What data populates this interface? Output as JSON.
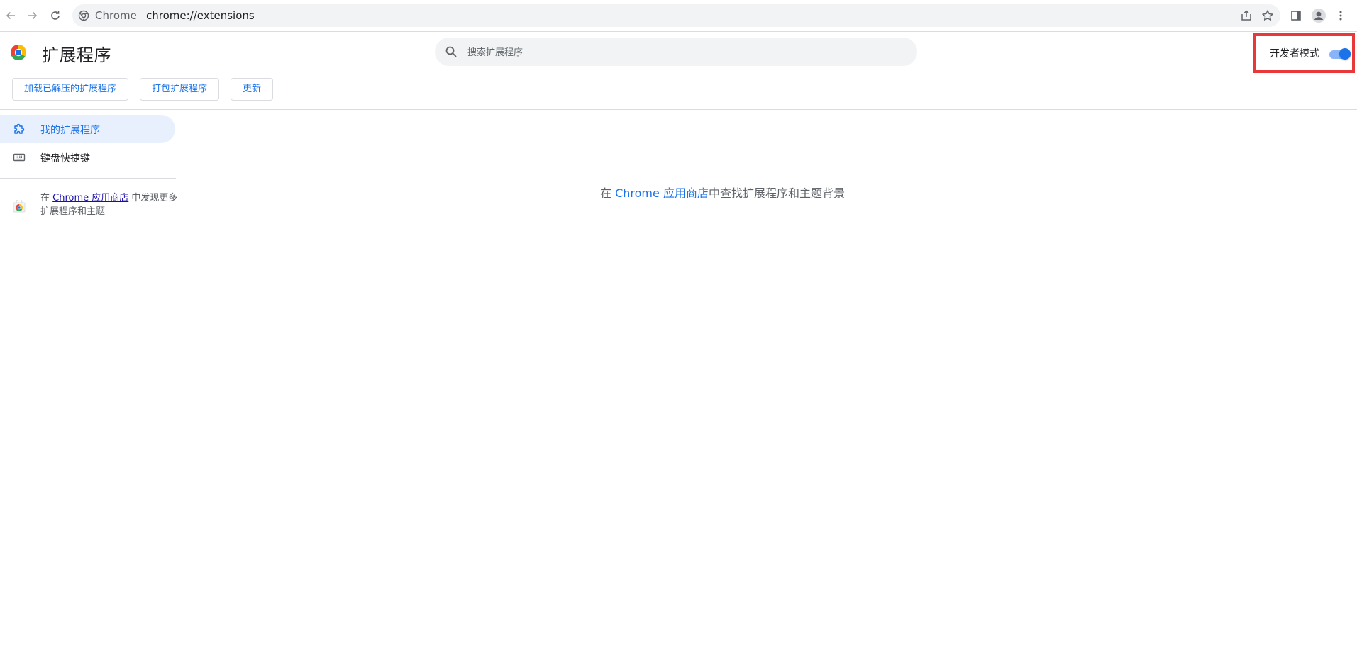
{
  "browser": {
    "omnibox": {
      "chip_label": "Chrome",
      "url": "chrome://extensions"
    }
  },
  "header": {
    "title": "扩展程序",
    "search": {
      "placeholder": "搜索扩展程序"
    },
    "developer_mode": {
      "label": "开发者模式",
      "enabled": true
    }
  },
  "actions": {
    "load_unpacked": "加载已解压的扩展程序",
    "pack": "打包扩展程序",
    "update": "更新"
  },
  "sidebar": {
    "items": [
      {
        "label": "我的扩展程序",
        "icon": "puzzle-icon",
        "active": true
      },
      {
        "label": "键盘快捷键",
        "icon": "keyboard-icon",
        "active": false
      }
    ],
    "store_promo": {
      "prefix": "在 ",
      "link": "Chrome 应用商店",
      "suffix": " 中发现更多扩展程序和主题"
    }
  },
  "main": {
    "empty_state": {
      "prefix": "在 ",
      "link": "Chrome 应用商店",
      "suffix": "中查找扩展程序和主题背景"
    }
  },
  "colors": {
    "accent": "#1a73e8",
    "active_nav_bg": "#e8f0fe",
    "highlight_border": "#e8383a",
    "omnibox_bg": "#f1f3f4"
  }
}
